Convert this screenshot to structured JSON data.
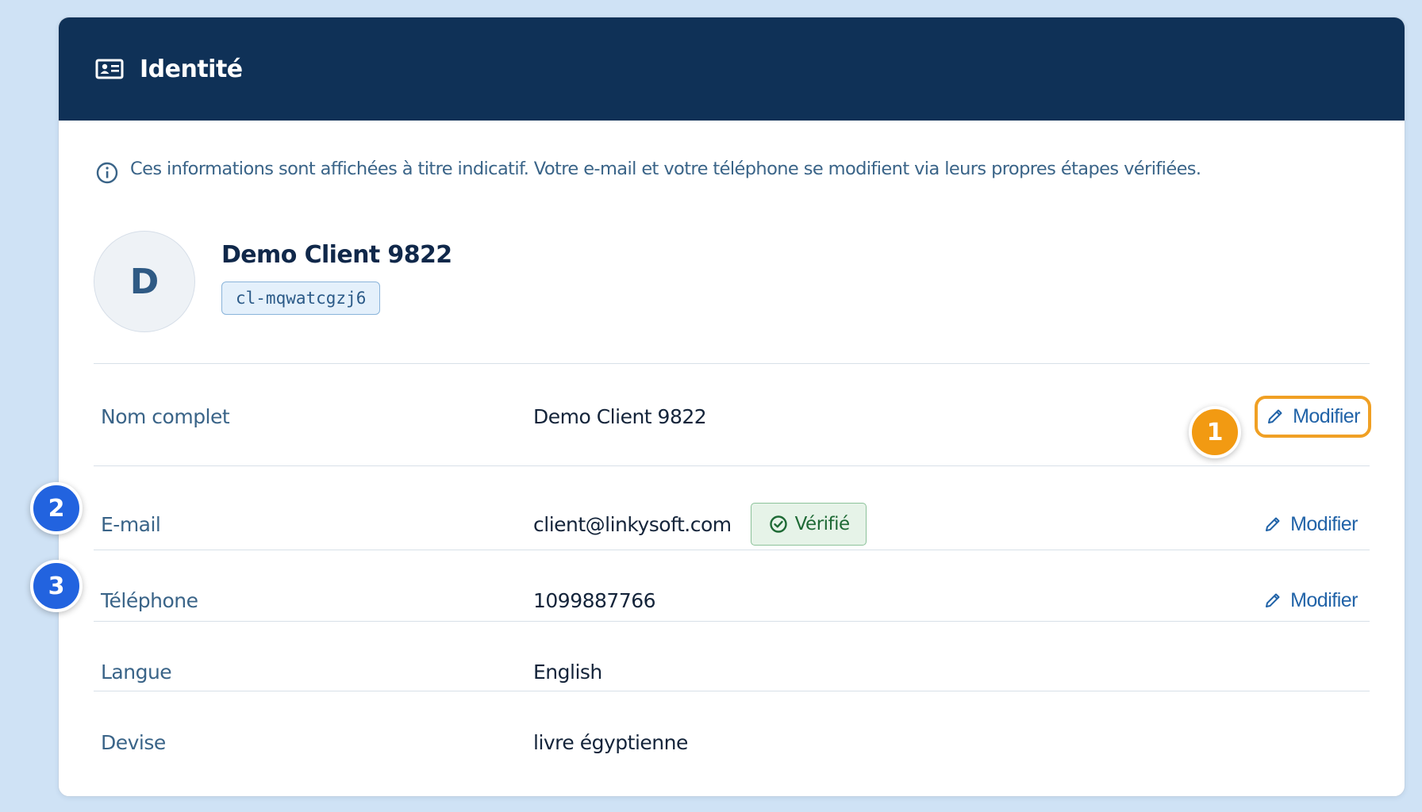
{
  "header": {
    "title": "Identité",
    "icon": "id-card-icon"
  },
  "notice": {
    "icon": "info-icon",
    "text": "Ces informations sont affichées à titre indicatif. Votre e-mail et votre téléphone se modifient via leurs propres étapes vérifiées."
  },
  "profile": {
    "avatar_initial": "D",
    "name": "Demo Client 9822",
    "client_id": "cl-mqwatcgzj6"
  },
  "fields": [
    {
      "label": "Nom complet",
      "value": "Demo Client 9822",
      "edit_label": "Modifier"
    },
    {
      "label": "E-mail",
      "value": "client@linkysoft.com",
      "badge": "Vérifié",
      "edit_label": "Modifier"
    },
    {
      "label": "Téléphone",
      "value": "1099887766",
      "edit_label": "Modifier"
    },
    {
      "label": "Langue",
      "value": "English"
    },
    {
      "label": "Devise",
      "value": "livre égyptienne"
    }
  ],
  "markers": [
    "1",
    "2",
    "3"
  ],
  "colors": {
    "header_bg": "#0f3157",
    "accent_link": "#2163a8",
    "marker_orange": "#f29a12",
    "marker_blue": "#2263df",
    "verified_green": "#1e6a35"
  }
}
